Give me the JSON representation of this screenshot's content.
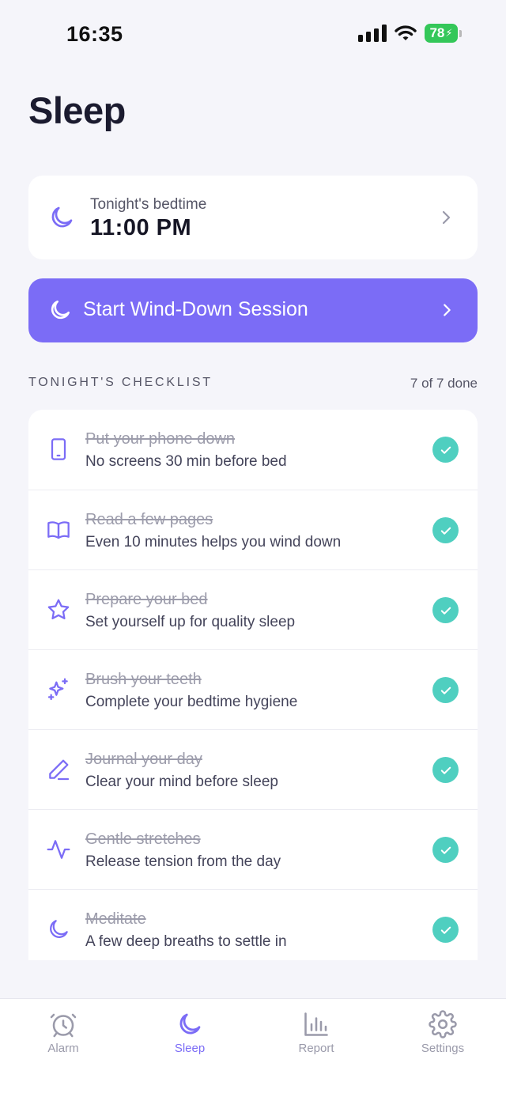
{
  "status_bar": {
    "time": "16:35",
    "battery": "78"
  },
  "page": {
    "title": "Sleep"
  },
  "bedtime": {
    "label": "Tonight's bedtime",
    "value": "11:00 PM"
  },
  "wind_down": {
    "label": "Start Wind-Down Session"
  },
  "checklist": {
    "header": "TONIGHT'S CHECKLIST",
    "count": "7 of 7 done",
    "items": [
      {
        "title": "Put your phone down",
        "subtitle": "No screens 30 min before bed",
        "icon": "phone-icon"
      },
      {
        "title": "Read a few pages",
        "subtitle": "Even 10 minutes helps you wind down",
        "icon": "book-icon"
      },
      {
        "title": "Prepare your bed",
        "subtitle": "Set yourself up for quality sleep",
        "icon": "star-icon"
      },
      {
        "title": "Brush your teeth",
        "subtitle": "Complete your bedtime hygiene",
        "icon": "sparkles-icon"
      },
      {
        "title": "Journal your day",
        "subtitle": "Clear your mind before sleep",
        "icon": "pen-icon"
      },
      {
        "title": "Gentle stretches",
        "subtitle": "Release tension from the day",
        "icon": "pulse-icon"
      },
      {
        "title": "Meditate",
        "subtitle": "A few deep breaths to settle in",
        "icon": "moon-icon"
      }
    ]
  },
  "tabs": [
    {
      "label": "Alarm",
      "icon": "alarm-clock-icon",
      "active": false
    },
    {
      "label": "Sleep",
      "icon": "moon-icon",
      "active": true
    },
    {
      "label": "Report",
      "icon": "bar-chart-icon",
      "active": false
    },
    {
      "label": "Settings",
      "icon": "gear-icon",
      "active": false
    }
  ],
  "colors": {
    "accent": "#7b6cf6",
    "check": "#4fcfc0",
    "background": "#f5f5fa",
    "battery": "#34c759"
  }
}
